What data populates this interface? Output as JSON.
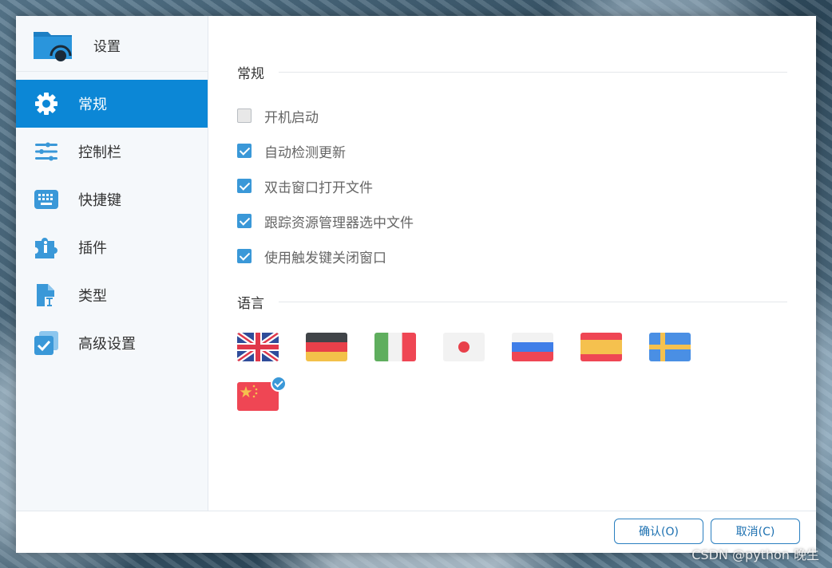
{
  "window": {
    "title": "设置"
  },
  "sidebar": {
    "items": [
      {
        "label": "常规",
        "icon": "gear-icon",
        "active": true
      },
      {
        "label": "控制栏",
        "icon": "sliders-icon",
        "active": false
      },
      {
        "label": "快捷键",
        "icon": "keyboard-icon",
        "active": false
      },
      {
        "label": "插件",
        "icon": "puzzle-icon",
        "active": false
      },
      {
        "label": "类型",
        "icon": "file-type-icon",
        "active": false
      },
      {
        "label": "高级设置",
        "icon": "advanced-icon",
        "active": false
      }
    ]
  },
  "general": {
    "title": "常规",
    "options": [
      {
        "label": "开机启动",
        "checked": false
      },
      {
        "label": "自动检测更新",
        "checked": true
      },
      {
        "label": "双击窗口打开文件",
        "checked": true
      },
      {
        "label": "跟踪资源管理器选中文件",
        "checked": true
      },
      {
        "label": "使用触发键关闭窗口",
        "checked": true
      }
    ]
  },
  "language": {
    "title": "语言",
    "flags": [
      {
        "name": "uk-flag-icon",
        "selected": false
      },
      {
        "name": "germany-flag-icon",
        "selected": false
      },
      {
        "name": "italy-flag-icon",
        "selected": false
      },
      {
        "name": "japan-flag-icon",
        "selected": false
      },
      {
        "name": "russia-flag-icon",
        "selected": false
      },
      {
        "name": "spain-flag-icon",
        "selected": false
      },
      {
        "name": "sweden-flag-icon",
        "selected": false
      },
      {
        "name": "china-flag-icon",
        "selected": true
      }
    ]
  },
  "footer": {
    "ok_label": "确认(O)",
    "cancel_label": "取消(C)"
  },
  "watermark": "CSDN @python 晚生",
  "colors": {
    "accent": "#0c87d6",
    "checkbox": "#3a98d8",
    "sidebar_bg": "#f5f8fb"
  }
}
